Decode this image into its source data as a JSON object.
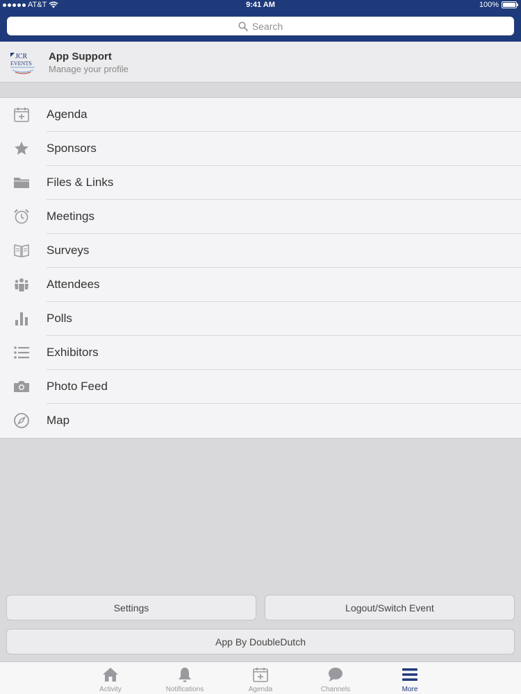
{
  "status_bar": {
    "carrier": "AT&T",
    "time": "9:41 AM",
    "battery": "100%"
  },
  "search": {
    "placeholder": "Search"
  },
  "profile": {
    "title": "App Support",
    "subtitle": "Manage your profile",
    "logo_top": "JCR",
    "logo_bottom": "EVENTS"
  },
  "menu": {
    "items": [
      {
        "label": "Agenda",
        "icon": "calendar-icon"
      },
      {
        "label": "Sponsors",
        "icon": "star-icon"
      },
      {
        "label": "Files & Links",
        "icon": "folder-icon"
      },
      {
        "label": "Meetings",
        "icon": "alarm-clock-icon"
      },
      {
        "label": "Surveys",
        "icon": "book-icon"
      },
      {
        "label": "Attendees",
        "icon": "people-icon"
      },
      {
        "label": "Polls",
        "icon": "bar-chart-icon"
      },
      {
        "label": "Exhibitors",
        "icon": "list-icon"
      },
      {
        "label": "Photo Feed",
        "icon": "camera-icon"
      },
      {
        "label": "Map",
        "icon": "compass-icon"
      }
    ]
  },
  "buttons": {
    "settings": "Settings",
    "logout": "Logout/Switch Event",
    "app_by": "App By DoubleDutch"
  },
  "tabs": [
    {
      "label": "Activity",
      "icon": "home-icon"
    },
    {
      "label": "Notifications",
      "icon": "bell-icon"
    },
    {
      "label": "Agenda",
      "icon": "calendar-icon"
    },
    {
      "label": "Channels",
      "icon": "chat-bubble-icon"
    },
    {
      "label": "More",
      "icon": "menu-icon"
    }
  ],
  "colors": {
    "brand": "#1f3a7a",
    "icon_gray": "#9a9a9e",
    "text": "#333333"
  }
}
